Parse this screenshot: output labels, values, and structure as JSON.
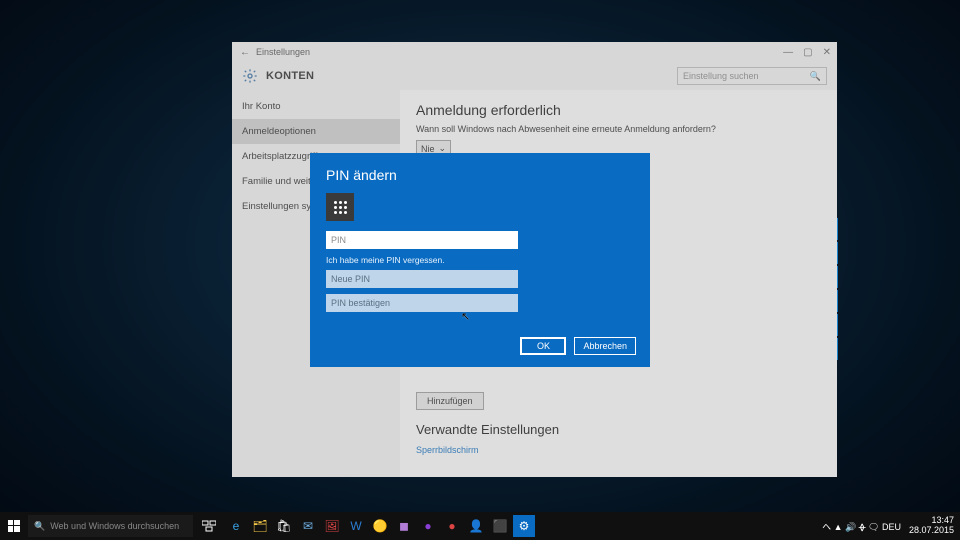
{
  "edgebars_count": 6,
  "settings_window": {
    "titlebar": {
      "back": "←",
      "label": "Einstellungen",
      "min": "—",
      "max": "▢",
      "close": "✕"
    },
    "header": {
      "title": "KONTEN",
      "search_placeholder": "Einstellung suchen"
    },
    "sidebar": {
      "items": [
        {
          "label": "Ihr Konto",
          "active": false
        },
        {
          "label": "Anmeldeoptionen",
          "active": true
        },
        {
          "label": "Arbeitsplatzzugriff",
          "active": false
        },
        {
          "label": "Familie und weitere Benutzer",
          "active": false
        },
        {
          "label": "Einstellungen synchronisieren",
          "active": false
        }
      ]
    },
    "content": {
      "section1_title": "Anmeldung erforderlich",
      "section1_text": "Wann soll Windows nach Abwesenheit eine erneute Anmeldung anfordern?",
      "dropdown_value": "Nie",
      "add_button": "Hinzufügen",
      "related_heading": "Verwandte Einstellungen",
      "related_link": "Sperrbildschirm"
    }
  },
  "pin_dialog": {
    "title": "PIN ändern",
    "pin_placeholder": "PIN",
    "forgot": "Ich habe meine PIN vergessen.",
    "new_pin_placeholder": "Neue PIN",
    "confirm_pin_placeholder": "PIN bestätigen",
    "ok": "OK",
    "cancel": "Abbrechen"
  },
  "taskbar": {
    "search_placeholder": "Web und Windows durchsuchen",
    "clock_time": "13:47",
    "clock_date": "28.07.2015",
    "tray_text": "ヘ ▲ 🔊 ᚖ 🗨 DEU"
  },
  "colors": {
    "accent": "#0a6bc2"
  }
}
